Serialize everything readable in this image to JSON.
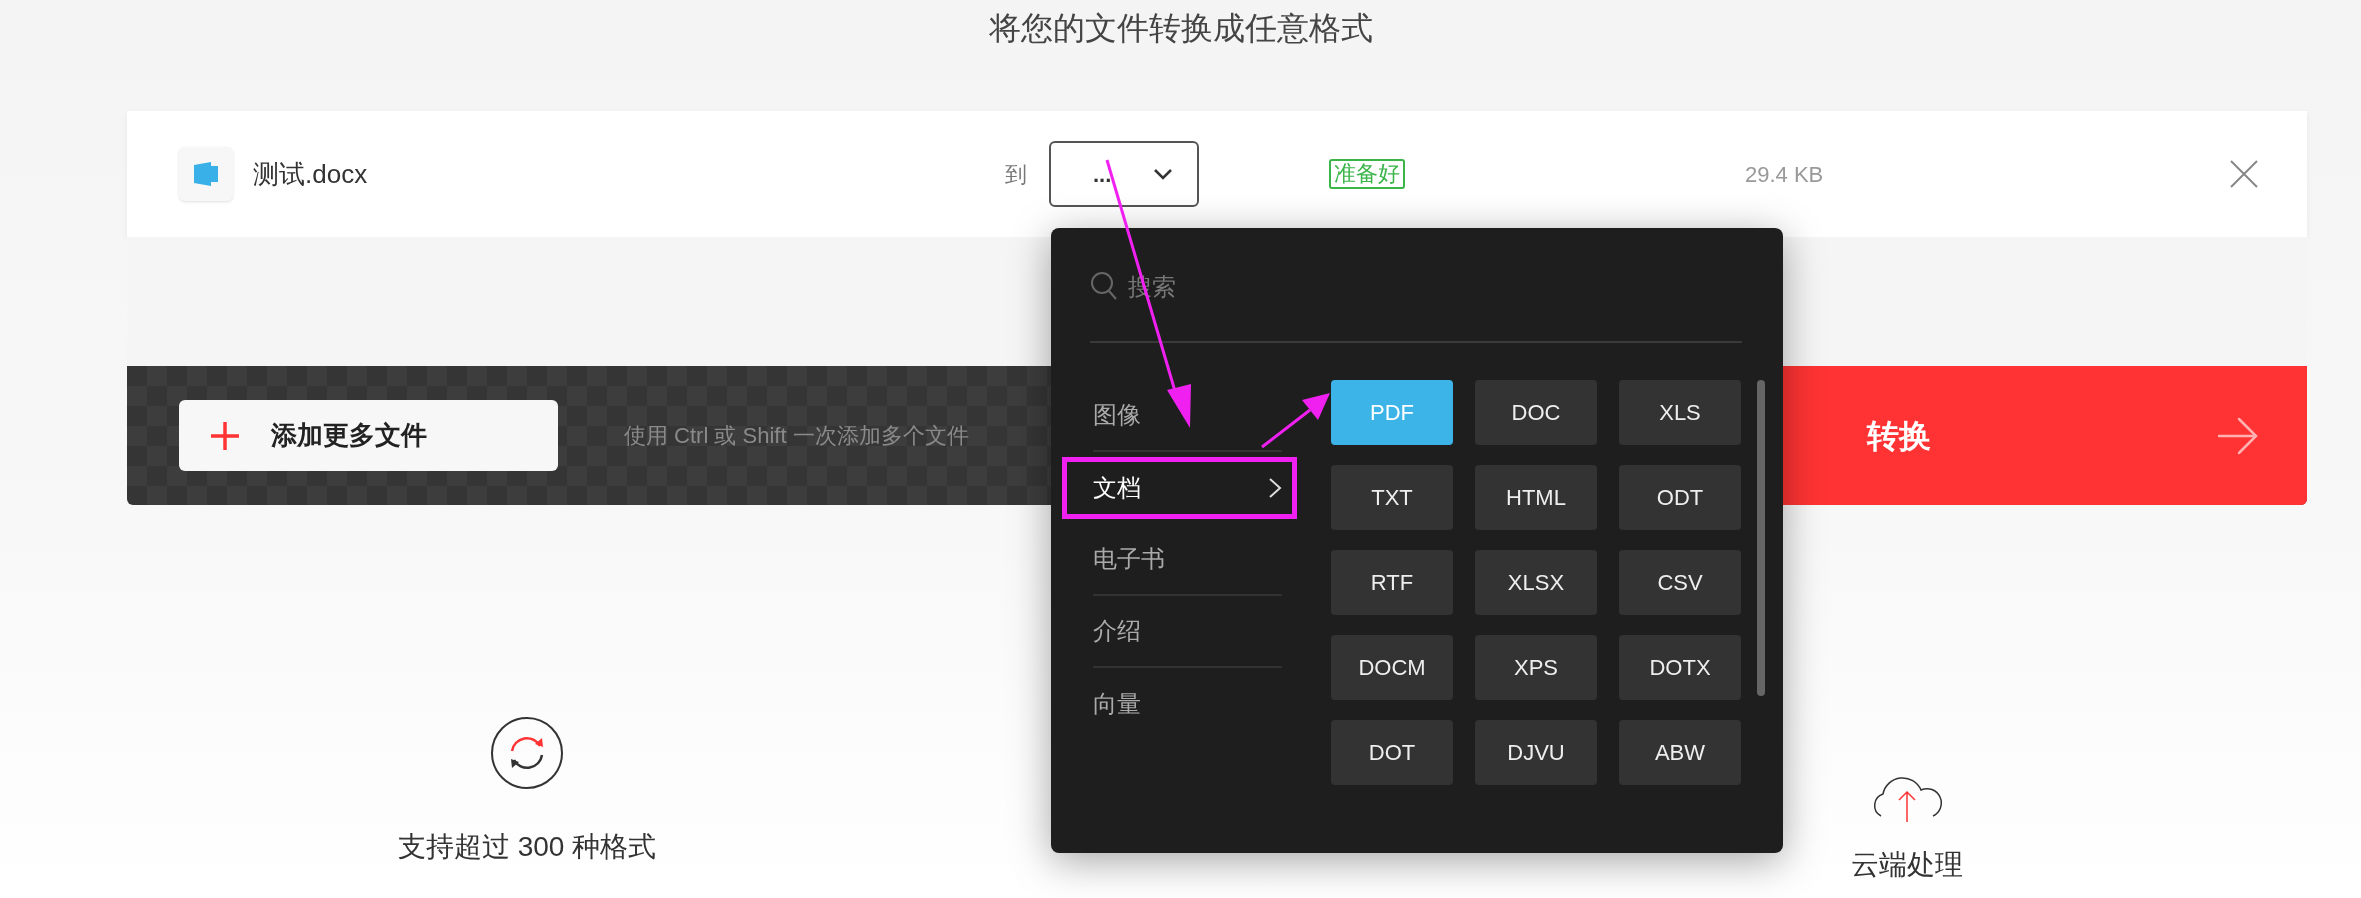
{
  "page": {
    "title": "将您的文件转换成任意格式"
  },
  "file": {
    "name": "测试.docx",
    "to_label": "到",
    "target": "...",
    "status": "准备好",
    "size": "29.4 KB"
  },
  "toolbar": {
    "add_button": "添加更多文件",
    "hint": "使用 Ctrl 或 Shift 一次添加多个文件",
    "convert_button": "转换"
  },
  "format_menu": {
    "search_placeholder": "搜索",
    "categories": [
      {
        "label": "图像",
        "selected": false
      },
      {
        "label": "文档",
        "selected": true
      },
      {
        "label": "电子书",
        "selected": false
      },
      {
        "label": "介绍",
        "selected": false
      },
      {
        "label": "向量",
        "selected": false
      }
    ],
    "formats": [
      {
        "label": "PDF",
        "selected": true
      },
      {
        "label": "DOC",
        "selected": false
      },
      {
        "label": "XLS",
        "selected": false
      },
      {
        "label": "TXT",
        "selected": false
      },
      {
        "label": "HTML",
        "selected": false
      },
      {
        "label": "ODT",
        "selected": false
      },
      {
        "label": "RTF",
        "selected": false
      },
      {
        "label": "XLSX",
        "selected": false
      },
      {
        "label": "CSV",
        "selected": false
      },
      {
        "label": "DOCM",
        "selected": false
      },
      {
        "label": "XPS",
        "selected": false
      },
      {
        "label": "DOTX",
        "selected": false
      },
      {
        "label": "DOT",
        "selected": false
      },
      {
        "label": "DJVU",
        "selected": false
      },
      {
        "label": "ABW",
        "selected": false
      }
    ]
  },
  "features": [
    {
      "kind": "formats",
      "label": "支持超过 300 种格式"
    },
    {
      "kind": "cloud",
      "label": "云端处理"
    }
  ]
}
